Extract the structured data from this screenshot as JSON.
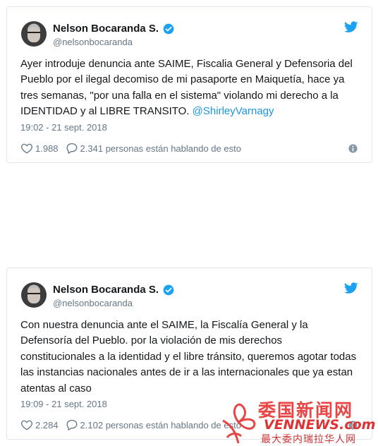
{
  "tweets": [
    {
      "name": "Nelson Bocaranda S.",
      "handle": "@nelsonbocaranda",
      "text": "Ayer introduje denuncia ante SAIME, Fiscalia General y Defensoria del Pueblo por el ilegal decomiso de mi pasaporte en Maiquetía, hace ya tres semanas, \"por una falla en el sistema\" violando mi derecho a la IDENTIDAD y al LIBRE TRANSITO.",
      "mention": "@ShirleyVarnagy",
      "time": "19:02 - 21 sept. 2018",
      "likes": "1.988",
      "conversation": "2.341 personas están hablando de esto"
    },
    {
      "name": "Nelson Bocaranda S.",
      "handle": "@nelsonbocaranda",
      "text": "Con nuestra denuncia ante el SAIME, la Fiscalía General y la Defensoría del Pueblo. por la violación de mis derechos constitucionales a la identidad y el libre tránsito, queremos agotar todas las instancias nacionales antes de ir a las internacionales que ya estan atentas al caso",
      "time": "19:09 - 21 sept. 2018",
      "likes": "2.284",
      "conversation": "2.102 personas están hablando de esto"
    }
  ],
  "icons": {
    "verified": "verified-badge-icon",
    "bird": "twitter-bird-icon",
    "heart": "heart-icon",
    "reply": "speech-bubble-icon",
    "info": "info-icon"
  },
  "colors": {
    "twitter_blue": "#1da1f2",
    "link_blue": "#1b95e0",
    "muted": "#657786",
    "watermark_red": "#e84545"
  },
  "watermark": {
    "title": "委国新闻网",
    "latin": "VENNEWS.com",
    "subtitle": "最大委内瑞拉华人网"
  }
}
